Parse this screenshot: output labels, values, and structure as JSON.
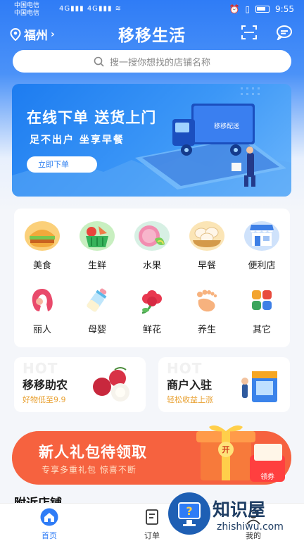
{
  "status_bar": {
    "carrier_1": "中国电信",
    "carrier_2": "中国电信",
    "net_1": "4G",
    "net_2": "4G",
    "time": "9:55"
  },
  "header": {
    "city": "福州",
    "app_title": "移移生活"
  },
  "search": {
    "placeholder": "搜一搜你想找的店铺名称"
  },
  "banner": {
    "title": "在线下单  送货上门",
    "subtitle": "足不出户  坐享早餐",
    "button": "立即下单",
    "truck_text": "移移配送"
  },
  "categories": [
    {
      "label": "美食",
      "icon": "burger-icon"
    },
    {
      "label": "生鲜",
      "icon": "basket-icon"
    },
    {
      "label": "水果",
      "icon": "fruit-icon"
    },
    {
      "label": "早餐",
      "icon": "steamer-icon"
    },
    {
      "label": "便利店",
      "icon": "store-icon"
    },
    {
      "label": "丽人",
      "icon": "hair-icon"
    },
    {
      "label": "母婴",
      "icon": "baby-bottle-icon"
    },
    {
      "label": "鲜花",
      "icon": "flower-icon"
    },
    {
      "label": "养生",
      "icon": "foot-icon"
    },
    {
      "label": "其它",
      "icon": "grid-icon"
    }
  ],
  "cards": [
    {
      "hot": "HOT",
      "title": "移移助农",
      "subtitle": "好物低至9.9"
    },
    {
      "hot": "HOT",
      "title": "商户入驻",
      "subtitle": "轻松收益上涨"
    }
  ],
  "promo": {
    "title": "新人礼包待领取",
    "subtitle": "专享多重礼包  惊喜不断",
    "box_label": "开",
    "coupon_label": "领券"
  },
  "nearby": {
    "title": "附近店铺"
  },
  "tabbar": {
    "home": "首页",
    "orders": "订单",
    "mine": "我的"
  },
  "watermark": {
    "name": "知识屋",
    "url": "zhishiwu.com"
  },
  "colors": {
    "primary": "#2f7cf6",
    "promo_red": "#f2553a",
    "accent_orange": "#e8a030"
  }
}
